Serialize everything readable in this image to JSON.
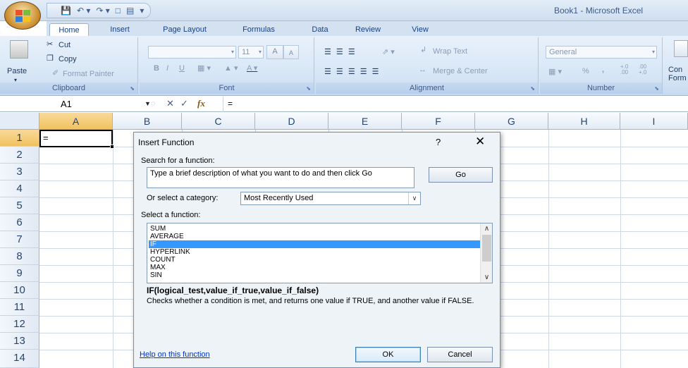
{
  "window": {
    "title": "Book1 - Microsoft Excel"
  },
  "quick_access": {
    "save_icon": "save-icon",
    "undo_icon": "undo-icon",
    "redo_icon": "redo-icon"
  },
  "tabs": [
    {
      "label": "Home"
    },
    {
      "label": "Insert"
    },
    {
      "label": "Page Layout"
    },
    {
      "label": "Formulas"
    },
    {
      "label": "Data"
    },
    {
      "label": "Review"
    },
    {
      "label": "View"
    }
  ],
  "ribbon": {
    "clipboard": {
      "label": "Clipboard",
      "paste": "Paste",
      "cut": "Cut",
      "copy": "Copy",
      "format_painter": "Format Painter"
    },
    "font": {
      "label": "Font",
      "size": "11",
      "bold": "B",
      "italic": "I",
      "underline": "U",
      "grow": "A",
      "shrink": "A"
    },
    "alignment": {
      "label": "Alignment",
      "wrap_text": "Wrap Text",
      "merge_center": "Merge & Center"
    },
    "number": {
      "label": "Number",
      "format": "General",
      "percent": "%",
      "comma": ",",
      "inc_decimal": "+.0 .00",
      "dec_decimal": ".00 +.0"
    },
    "styles": {
      "conditional_formatting": "Con Form"
    }
  },
  "formula_bar": {
    "name_box": "A1",
    "cancel": "✕",
    "enter": "✓",
    "fx": "fx",
    "content": "="
  },
  "grid": {
    "columns": [
      "A",
      "B",
      "C",
      "D",
      "E",
      "F",
      "G",
      "H",
      "I"
    ],
    "rows": [
      "1",
      "2",
      "3",
      "4",
      "5",
      "6",
      "7",
      "8",
      "9",
      "10",
      "11",
      "12",
      "13",
      "14"
    ],
    "active_cell": "A1",
    "active_cell_value": "="
  },
  "dialog": {
    "title": "Insert Function",
    "help_glyph": "?",
    "close_glyph": "✕",
    "search_label": "Search for a function:",
    "search_value": "Type a brief description of what you want to do and then click Go",
    "go_button": "Go",
    "category_label": "Or select a category:",
    "category_value": "Most Recently Used",
    "select_label": "Select a function:",
    "functions": [
      "SUM",
      "AVERAGE",
      "IF",
      "HYPERLINK",
      "COUNT",
      "MAX",
      "SIN"
    ],
    "selected_function": "IF",
    "syntax": "IF(logical_test,value_if_true,value_if_false)",
    "description": "Checks whether a condition is met, and returns one value if TRUE, and another value if FALSE.",
    "help_link": "Help on this function",
    "ok_button": "OK",
    "cancel_button": "Cancel"
  }
}
